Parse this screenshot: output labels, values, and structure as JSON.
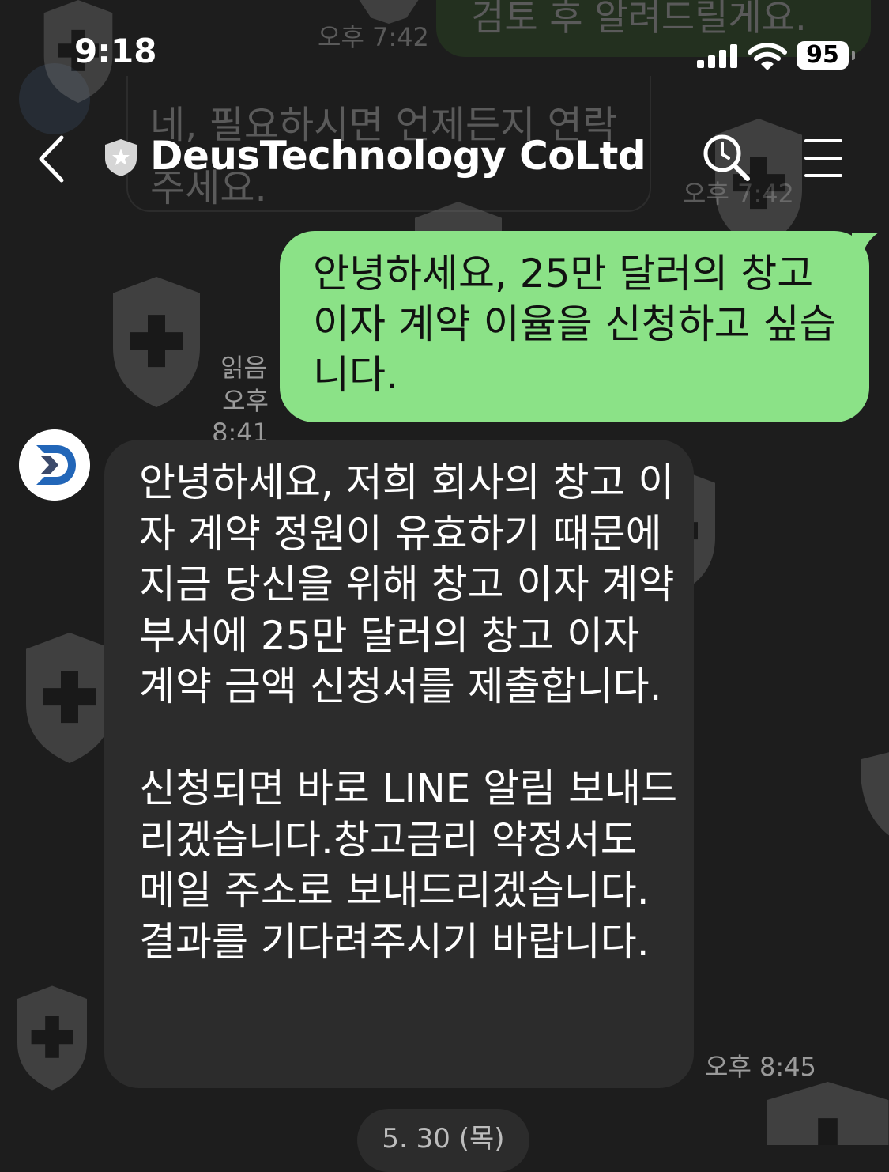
{
  "status_bar": {
    "time": "9:18",
    "battery": "95"
  },
  "header": {
    "title": "DeusTechnology CoLtd",
    "back_icon": "chevron-left-icon",
    "badge_icon": "shield-star-icon",
    "search_icon": "search-clock-icon",
    "menu_icon": "hamburger-menu-icon"
  },
  "background_messages": {
    "top_time": "오후 7:42",
    "top_message": "검토 후 알려드릴게요.",
    "partial_message_line1": "네, 필요하시면 언제든지 연락",
    "partial_message_line2": "주세요.",
    "partial_time": "오후 7:42"
  },
  "messages": [
    {
      "direction": "outgoing",
      "text": "안녕하세요, 25만 달러의 창고 이자 계약 이율을 신청하고 싶습니다.",
      "read_label": "읽음",
      "time": "오후 8:41"
    },
    {
      "direction": "incoming",
      "sender": "DeusTechnology CoLtd",
      "text": "안녕하세요, 저희 회사의 창고 이자 계약 정원이 유효하기 때문에 지금 당신을 위해 창고 이자 계약 부서에 25만 달러의 창고 이자 계약 금액 신청서를 제출합니다.\n\n신청되면 바로 LINE  알림 보내드리겠습니다.창고금리 약정서도 메일 주소로 보내드리겠습니다.결과를 기다려주시기 바랍니다.",
      "time": "오후 8:45"
    }
  ],
  "date_divider": "5. 30 (목)",
  "colors": {
    "background": "#1d1d1d",
    "outgoing_bubble": "#8be287",
    "incoming_bubble": "#2c2c2c",
    "meta_text": "#9a9a9a",
    "watermark": "#8a8a8a"
  }
}
